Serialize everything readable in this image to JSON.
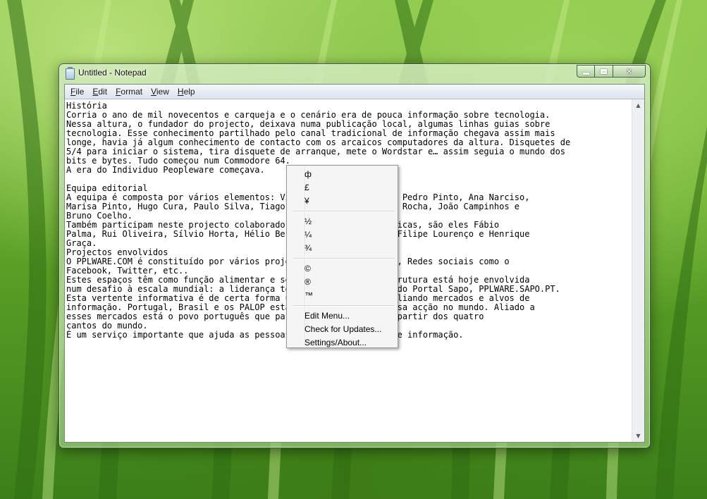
{
  "window": {
    "title": "Untitled - Notepad",
    "close_glyph": "✕"
  },
  "menubar": {
    "items": [
      {
        "accel": "F",
        "rest": "ile"
      },
      {
        "accel": "E",
        "rest": "dit"
      },
      {
        "accel": "F",
        "rest": "ormat",
        "accel_pos": "first"
      },
      {
        "accel": "V",
        "rest": "iew"
      },
      {
        "accel": "H",
        "rest": "elp"
      }
    ]
  },
  "editor": {
    "lines": [
      "História",
      "Corria o ano de mil novecentos e carqueja e o cenário era de pouca informação sobre tecnologia.",
      "Nessa altura, o fundador do projecto, deixava numa publicação local, algumas linhas guias sobre",
      "tecnologia. Esse conhecimento partilhado pelo canal tradicional de informação chegava assim mais",
      "longe, havia já algum conhecimento de contacto com os arcaicos computadores da altura. Disquetes de",
      "5/4 para iniciar o sistema, tira disquete de arranque, mete o Wordstar e… assim seguia o mundo dos",
      "bits e bytes. Tudo começou num Commodore 64.",
      "A era do Individuo Peopleware começava.",
      "",
      "Equipa editorial",
      "A equipa é composta por vários elementos: Vítor M., Pedro Simões, Pedro Pinto, Ana Narciso,",
      "Marisa Pinto, Hugo Cura, Paulo Silva, Tiago Ramos, Filipe, Manuel Rocha, João Campinhos e",
      "Bruno Coelho.",
      "Também participam neste projecto colaboradores para áreas especificas, são eles Fábio",
      "Palma, Rui Oliveira, Sílvio Horta, Hélio Bernardino, Bernardino, Filipe Lourenço e Henrique",
      "Graça.",
      "Projectos envolvidos",
      "O PPLWARE.COM é constituído por vários projectos: o Site, o Fórum, Redes sociais como o",
      "Facebook, Twitter, etc..",
      "Estes espaços têm como função alimentar e servir o todo. Essa estrutura está hoje envolvida",
      "num desafio à escala mundial: a liderança tecnológica tecnologia do Portal Sapo, PPLWARE.SAPO.PT.",
      "Esta vertente informativa é de certa forma um acto colectivo, ampliando mercados e alvos de",
      "informação. Portugal, Brasil e os PALOP estão abrangidos pela nossa acção no mundo. Aliado a",
      "esses mercados está o povo português que participa activamente a partir dos quatro",
      "cantos do mundo.",
      "É um serviço importante que ajuda as pessoas com as tecnologias de informação."
    ]
  },
  "context_menu": {
    "groups": [
      [
        "ф",
        "£",
        "¥"
      ],
      [
        "½",
        "¼",
        "¾"
      ],
      [
        "©",
        "®",
        "™"
      ],
      [
        "Edit Menu...",
        "Check for Updates...",
        "Settings/About..."
      ]
    ]
  },
  "scrollbar": {
    "up_glyph": "▲",
    "down_glyph": "▼"
  }
}
